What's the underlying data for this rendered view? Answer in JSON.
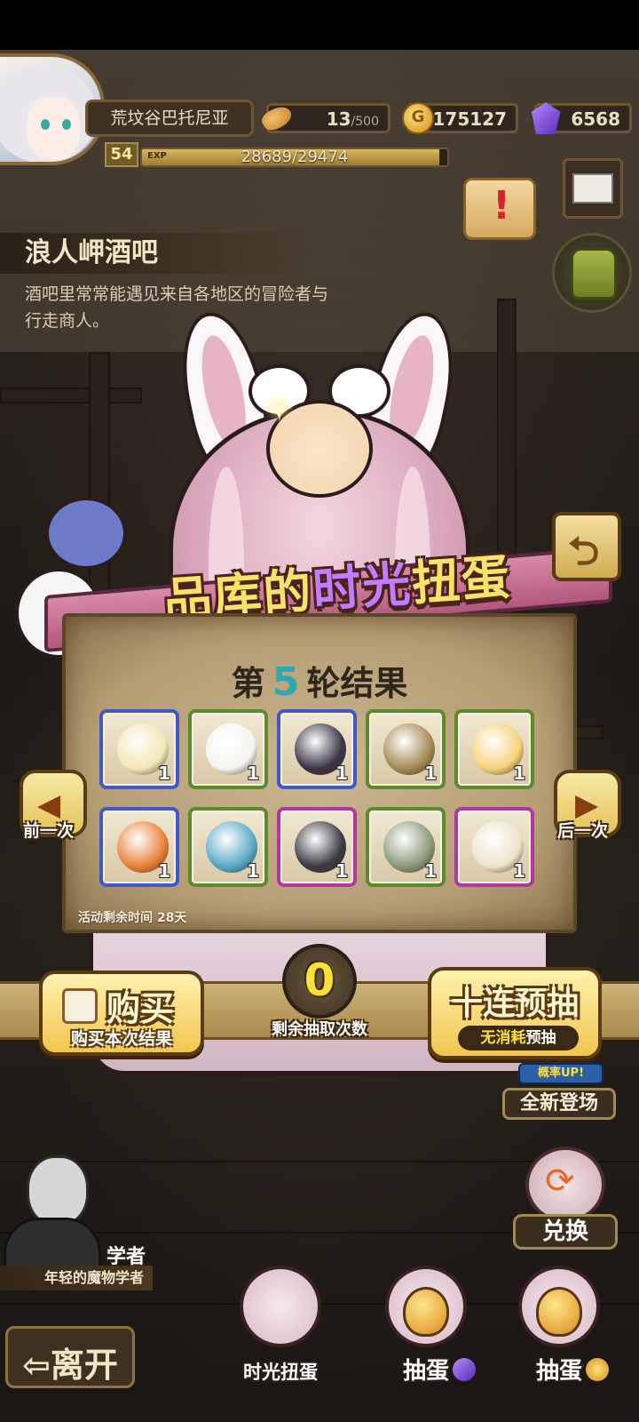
{
  "header": {
    "player_name": "荒坟谷巴托尼亚",
    "stamina": "13",
    "stamina_max": "/500",
    "gold_symbol": "G",
    "gold": "175127",
    "gems": "6568",
    "level": "54",
    "exp_label": "EXP",
    "exp_text": "28689/29474",
    "exp_progress": 0.9734
  },
  "location": {
    "name": "浪人岬酒吧",
    "description": "酒吧里常常能遇见来自各地区的冒险者与行走商人。"
  },
  "event": {
    "title_prefix": "品库的",
    "title_highlight": "时光",
    "title_suffix": "扭蛋",
    "round_prefix": "第",
    "round_number": "5",
    "round_suffix": "轮结果",
    "remaining_time": "活动剩余时间  28天"
  },
  "items": [
    {
      "name": "lotus-bud-item",
      "qty": "1",
      "rarity": "rare",
      "color": "#f1e7b6"
    },
    {
      "name": "radish-item",
      "qty": "1",
      "rarity": "common",
      "color": "#f4f4f0"
    },
    {
      "name": "dark-creature-item",
      "qty": "1",
      "rarity": "rare",
      "color": "#3a3548"
    },
    {
      "name": "wrapped-egg-item",
      "qty": "1",
      "rarity": "common",
      "color": "#a68a54"
    },
    {
      "name": "jelly-item",
      "qty": "1",
      "rarity": "common",
      "color": "#f7d27a"
    },
    {
      "name": "fire-claw-item",
      "qty": "1",
      "rarity": "rare",
      "color": "#e8823a"
    },
    {
      "name": "spiral-shell-item",
      "qty": "1",
      "rarity": "common",
      "color": "#5aaac8"
    },
    {
      "name": "jackal-mask-item",
      "qty": "1",
      "rarity": "epic",
      "color": "#3c3a44"
    },
    {
      "name": "leaf-item",
      "qty": "1",
      "rarity": "common",
      "color": "#8c9a7a"
    },
    {
      "name": "nest-egg-item",
      "qty": "1",
      "rarity": "epic",
      "color": "#eee4cc"
    }
  ],
  "nav": {
    "prev_label": "前一次",
    "next_label": "后一次",
    "prev_arrow": "◀",
    "next_arrow": "▶"
  },
  "actions": {
    "buy_label": "购买",
    "buy_sub": "购买本次结果",
    "draws_left": "0",
    "draws_left_label": "剩余抽取次数",
    "ten_pull_label": "十连预抽",
    "ten_pull_sub_hl": "无消耗",
    "ten_pull_sub": "预抽"
  },
  "promo": {
    "rate_up": "概率UP!",
    "new_arrival": "全新登场"
  },
  "exchange_label": "兑换",
  "npc": {
    "name": "学者",
    "description": "年轻的魔物学者"
  },
  "leave_label": "⇦离开",
  "dock": [
    {
      "label": "时光扭蛋",
      "currency": ""
    },
    {
      "label": "抽蛋",
      "currency": "gem"
    },
    {
      "label": "抽蛋",
      "currency": "gold"
    }
  ],
  "back_arrow": "⮌",
  "colors": {
    "rare_border": "#4159c8",
    "common_border": "#5d8a2c",
    "epic_border": "#b0389e",
    "accent_yellow": "#ffe034"
  }
}
